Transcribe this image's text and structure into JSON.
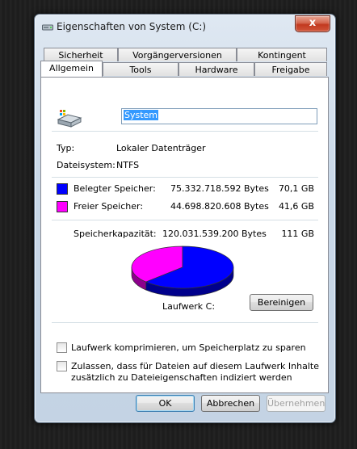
{
  "window": {
    "title": "Eigenschaften von System (C:)",
    "close_glyph": "x",
    "accent_close": "#c2391f"
  },
  "tabs": {
    "row_top": [
      "Sicherheit",
      "Vorgängerversionen",
      "Kontingent"
    ],
    "row_bottom": [
      "Allgemein",
      "Tools",
      "Hardware",
      "Freigabe"
    ],
    "active": "Allgemein"
  },
  "general": {
    "drive_icon": "drive-icon",
    "name_value": "System",
    "type_label": "Typ:",
    "type_value": "Lokaler Datenträger",
    "fs_label": "Dateisystem:",
    "fs_value": "NTFS",
    "used": {
      "label": "Belegter Speicher:",
      "bytes": "75.332.718.592 Bytes",
      "size": "70,1 GB",
      "color": "#0000ff"
    },
    "free": {
      "label": "Freier Speicher:",
      "bytes": "44.698.820.608 Bytes",
      "size": "41,6 GB",
      "color": "#ff00ff"
    },
    "capacity": {
      "label": "Speicherkapazität:",
      "bytes": "120.031.539.200 Bytes",
      "size": "111 GB"
    },
    "used_fraction": 0.6276,
    "drive_label": "Laufwerk C:",
    "cleanup_button": "Bereinigen",
    "compress_checkbox": "Laufwerk komprimieren, um Speicherplatz zu sparen",
    "index_checkbox_line1": "Zulassen, dass für Dateien auf diesem Laufwerk Inhalte",
    "index_checkbox_line2": "zusätzlich zu Dateieigenschaften indiziert werden",
    "compress_checked": false,
    "index_checked": false
  },
  "buttons": {
    "ok": "OK",
    "cancel": "Abbrechen",
    "apply": "Übernehmen"
  }
}
